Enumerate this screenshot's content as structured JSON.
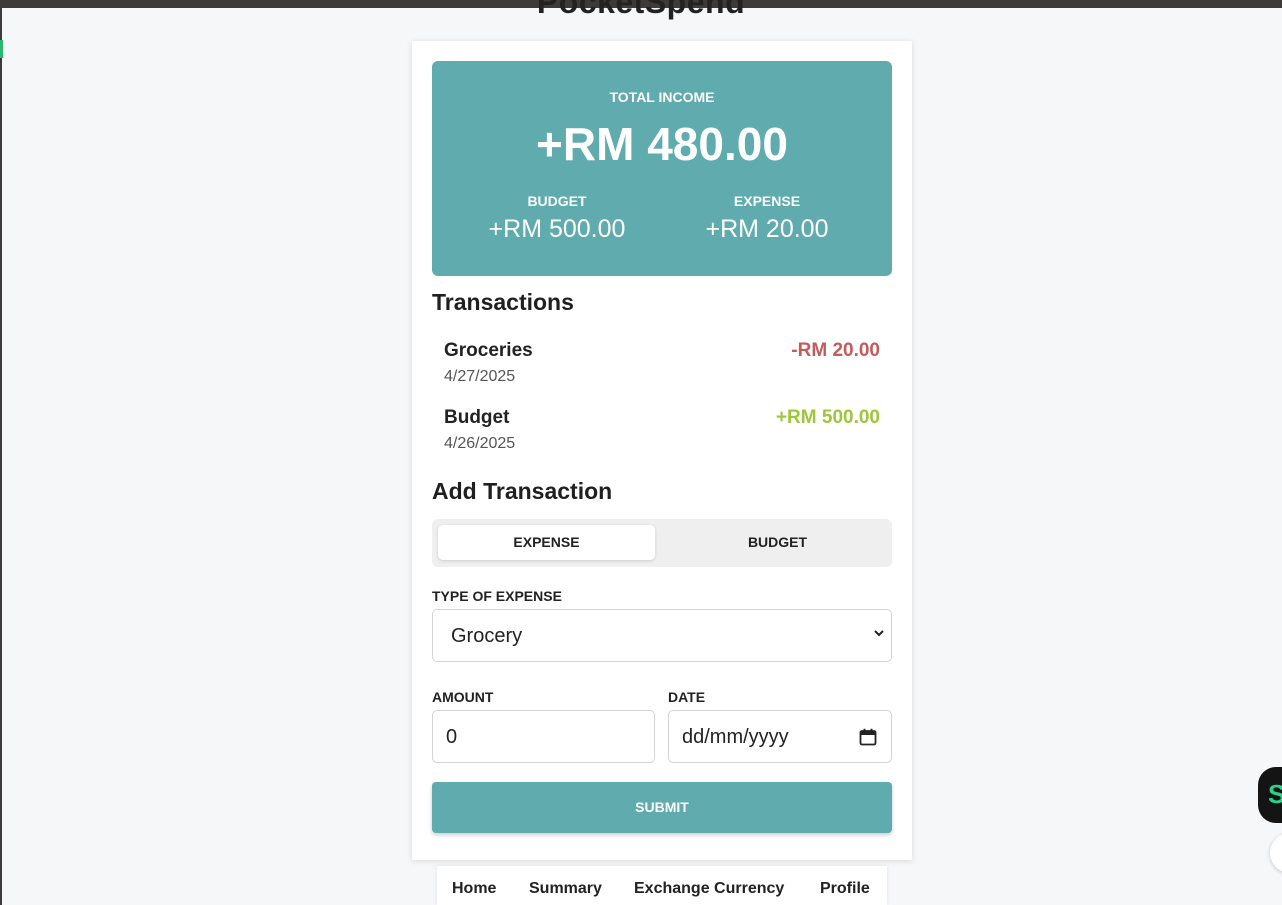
{
  "app": {
    "title": "PocketSpend"
  },
  "summary": {
    "total_label": "TOTAL INCOME",
    "total_value": "+RM 480.00",
    "budget_label": "BUDGET",
    "budget_value": "+RM 500.00",
    "expense_label": "EXPENSE",
    "expense_value": "+RM 20.00"
  },
  "transactions": {
    "title": "Transactions",
    "items": [
      {
        "name": "Groceries",
        "date": "4/27/2025",
        "amount": "-RM 20.00"
      },
      {
        "name": "Budget",
        "date": "4/26/2025",
        "amount": "+RM 500.00"
      }
    ]
  },
  "add": {
    "title": "Add Transaction",
    "toggle": [
      "EXPENSE",
      "BUDGET"
    ],
    "type_label": "TYPE OF EXPENSE",
    "type_value": "Grocery",
    "amount_label": "AMOUNT",
    "amount_value": "0",
    "date_label": "DATE",
    "date_placeholder": "dd/mm/yyyy",
    "submit_label": "SUBMIT"
  },
  "nav": {
    "items": [
      "Home",
      "Summary",
      "Exchange Currency",
      "Profile"
    ]
  },
  "colors": {
    "accent": "#5fabad",
    "negative": "#c35b5b",
    "positive": "#9dc63b"
  },
  "icons": {
    "dropdown": "chevron-down-icon",
    "calendar": "calendar-icon"
  }
}
